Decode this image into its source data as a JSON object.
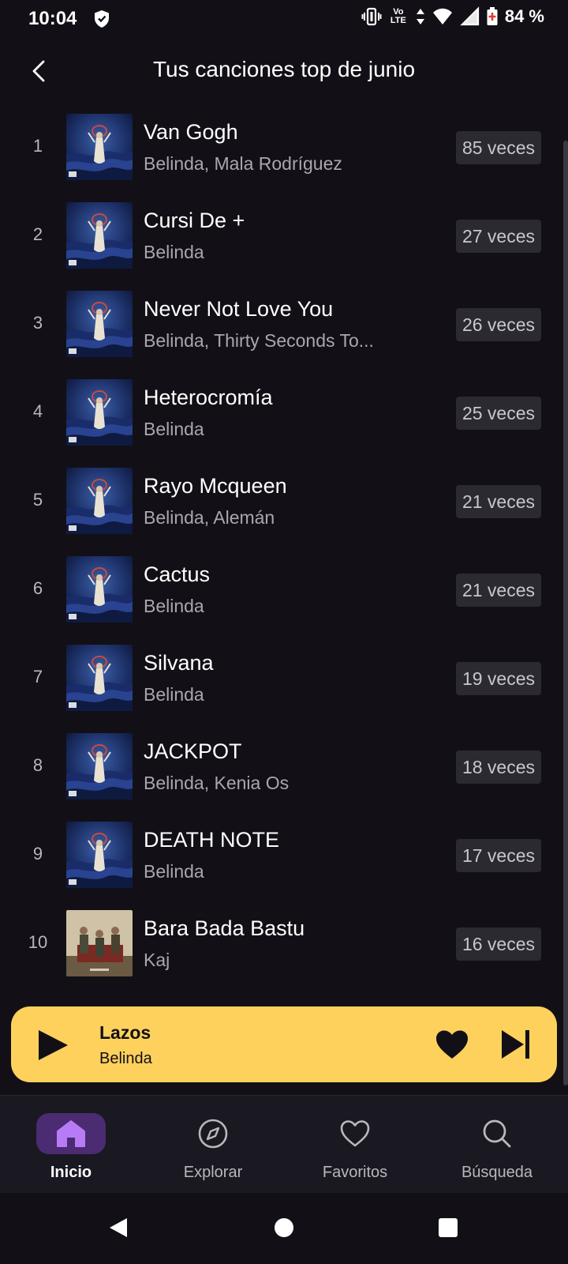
{
  "status_bar": {
    "time": "10:04",
    "network_label": "Vo LTE",
    "battery": "84 %",
    "icons": [
      "shield-icon",
      "vibrate-icon",
      "volte-icon",
      "data-arrows-icon",
      "wifi-icon",
      "signal-icon",
      "battery-icon"
    ]
  },
  "header": {
    "title": "Tus canciones top de junio",
    "back_icon": "chevron-left-icon"
  },
  "songs": [
    {
      "rank": "1",
      "title": "Van Gogh",
      "artist": "Belinda, Mala Rodríguez",
      "plays": "85 veces",
      "cover": "belinda-cover"
    },
    {
      "rank": "2",
      "title": "Cursi De +",
      "artist": "Belinda",
      "plays": "27 veces",
      "cover": "belinda-cover"
    },
    {
      "rank": "3",
      "title": "Never Not Love You",
      "artist": "Belinda, Thirty Seconds To...",
      "plays": "26 veces",
      "cover": "belinda-cover"
    },
    {
      "rank": "4",
      "title": "Heterocromía",
      "artist": "Belinda",
      "plays": "25 veces",
      "cover": "belinda-cover"
    },
    {
      "rank": "5",
      "title": "Rayo Mcqueen",
      "artist": "Belinda, Alemán",
      "plays": "21 veces",
      "cover": "belinda-cover"
    },
    {
      "rank": "6",
      "title": "Cactus",
      "artist": "Belinda",
      "plays": "21 veces",
      "cover": "belinda-cover"
    },
    {
      "rank": "7",
      "title": "Silvana",
      "artist": "Belinda",
      "plays": "19 veces",
      "cover": "belinda-cover"
    },
    {
      "rank": "8",
      "title": "JACKPOT",
      "artist": "Belinda, Kenia Os",
      "plays": "18 veces",
      "cover": "belinda-cover"
    },
    {
      "rank": "9",
      "title": "DEATH NOTE",
      "artist": "Belinda",
      "plays": "17 veces",
      "cover": "belinda-cover"
    },
    {
      "rank": "10",
      "title": "Bara Bada Bastu",
      "artist": "Kaj",
      "plays": "16 veces",
      "cover": "kaj-cover"
    }
  ],
  "mini_player": {
    "title": "Lazos",
    "artist": "Belinda",
    "icons": [
      "play-icon",
      "heart-icon",
      "skip-next-icon"
    ]
  },
  "bottom_nav": {
    "items": [
      {
        "label": "Inicio",
        "icon": "home-icon",
        "active": true
      },
      {
        "label": "Explorar",
        "icon": "compass-icon",
        "active": false
      },
      {
        "label": "Favoritos",
        "icon": "heart-outline-icon",
        "active": false
      },
      {
        "label": "Búsqueda",
        "icon": "search-icon",
        "active": false
      }
    ]
  },
  "colors": {
    "background": "#121016",
    "accent_player": "#fdd15c",
    "nav_active": "#4b2b72",
    "nav_active_icon": "#b77cf5",
    "badge": "#2c2a31"
  }
}
